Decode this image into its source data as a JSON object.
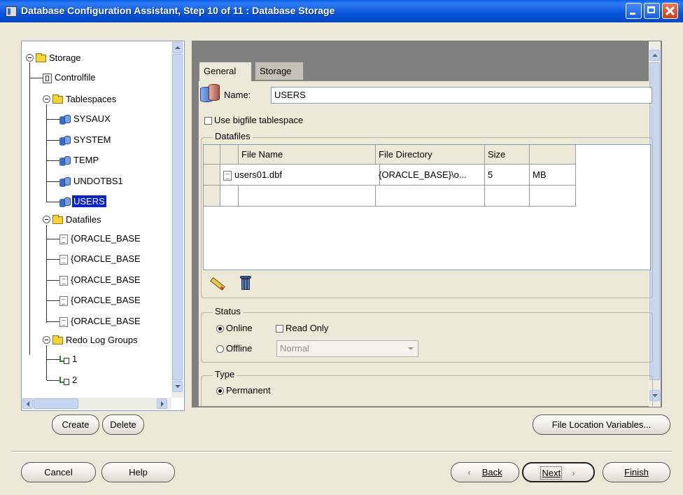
{
  "window": {
    "title": "Database Configuration Assistant, Step 10 of 11 : Database Storage"
  },
  "tree": {
    "root": "Storage",
    "controlfile": "Controlfile",
    "tablespaces": "Tablespaces",
    "tablespace_items": [
      "SYSAUX",
      "SYSTEM",
      "TEMP",
      "UNDOTBS1",
      "USERS"
    ],
    "selected": "USERS",
    "datafiles": "Datafiles",
    "datafile_items": [
      "{ORACLE_BASE",
      "{ORACLE_BASE",
      "{ORACLE_BASE",
      "{ORACLE_BASE",
      "{ORACLE_BASE"
    ],
    "redo": "Redo Log Groups",
    "redo_items": [
      "1",
      "2"
    ]
  },
  "tree_buttons": {
    "create": "Create",
    "delete": "Delete"
  },
  "tabs": {
    "general": "General",
    "storage": "Storage"
  },
  "general": {
    "name_label": "Name:",
    "name_value": "USERS",
    "bigfile_label": "Use bigfile tablespace",
    "bigfile_checked": false,
    "datafiles_title": "Datafiles",
    "columns": [
      "File Name",
      "File Directory",
      "Size",
      ""
    ],
    "rows": [
      {
        "file_name": "users01.dbf",
        "file_directory": "{ORACLE_BASE}\\o...",
        "size": "5",
        "unit": "MB"
      }
    ],
    "status_title": "Status",
    "online_label": "Online",
    "read_only_label": "Read Only",
    "offline_label": "Offline",
    "offline_mode": "Normal",
    "status_selected": "Online",
    "type_title": "Type",
    "permanent_label": "Permanent",
    "type_selected": "Permanent"
  },
  "file_location_button": "File Location Variables...",
  "footer": {
    "cancel": "Cancel",
    "help": "Help",
    "back": "Back",
    "next": "Next",
    "finish": "Finish"
  },
  "colors": {
    "title_bar": "#0a5fe8",
    "selection": "#0a24c8",
    "dialog_bg": "#ece9d8"
  }
}
